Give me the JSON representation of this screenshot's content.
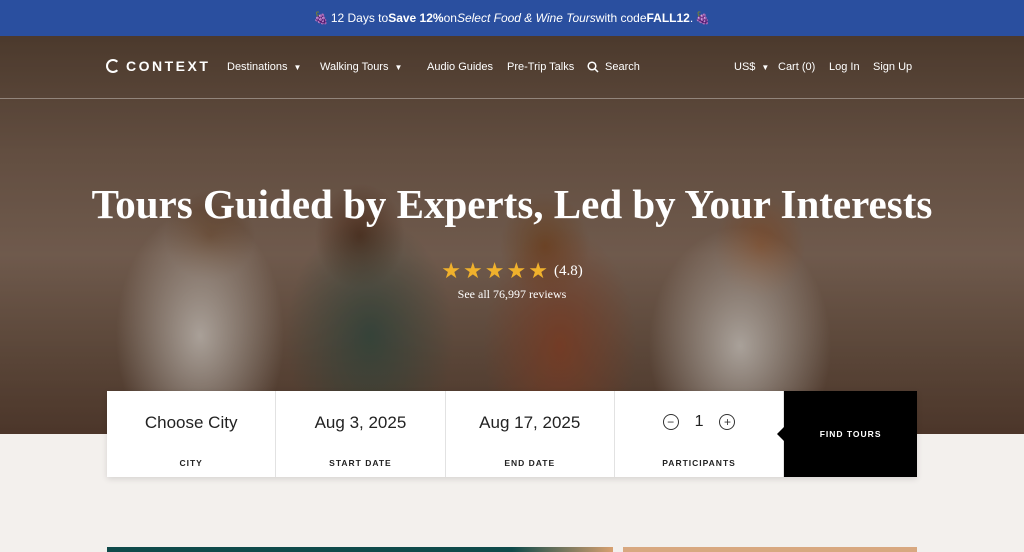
{
  "promo": {
    "emoji_left": "🍇",
    "pre": "12 Days to ",
    "bold1": "Save 12%",
    "mid": " on ",
    "italic": "Select Food & Wine Tours",
    "post": " with code ",
    "code": "FALL12",
    "end": ".",
    "emoji_right": "🍇"
  },
  "nav": {
    "logo": "CONTEXT",
    "destinations": "Destinations",
    "walking_tours": "Walking Tours",
    "audio_guides": "Audio Guides",
    "pre_trip": "Pre-Trip Talks",
    "search": "Search",
    "currency": "US$",
    "cart": "Cart (0)",
    "login": "Log In",
    "signup": "Sign Up"
  },
  "hero": {
    "title": "Tours Guided by Experts, Led by Your Interests",
    "rating": "(4.8)",
    "stars": 5,
    "reviews": "See all 76,997 reviews"
  },
  "search": {
    "city_value": "Choose City",
    "city_label": "CITY",
    "start_value": "Aug 3, 2025",
    "start_label": "START DATE",
    "end_value": "Aug 17, 2025",
    "end_label": "END DATE",
    "participants_value": "1",
    "participants_label": "PARTICIPANTS",
    "minus": "−",
    "plus": "+",
    "find_label": "FIND TOURS"
  },
  "colors": {
    "promo_bg": "#2a4f9f",
    "star": "#f0b12c",
    "find_bg": "#000000"
  }
}
